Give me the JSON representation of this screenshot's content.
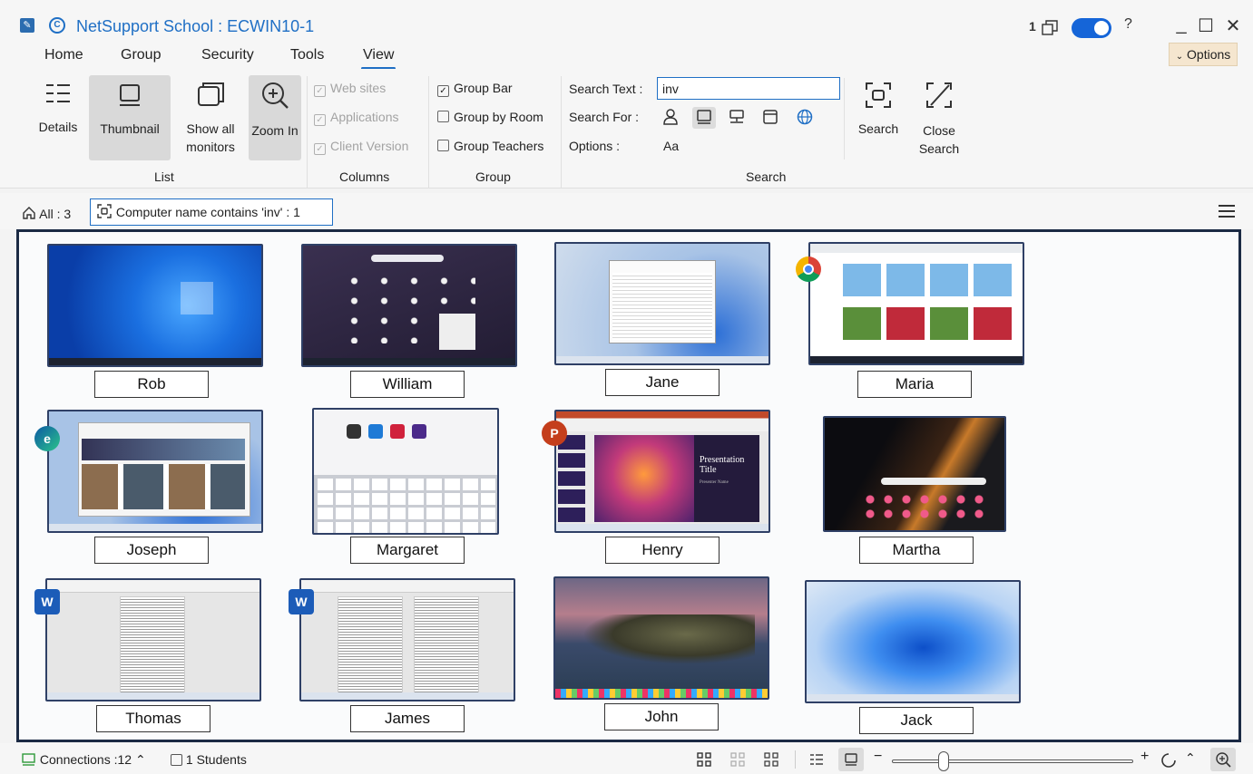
{
  "window": {
    "title": "NetSupport School : ECWIN10-1",
    "notification_count": "1",
    "help": "?",
    "minimize": "_",
    "maximize": "☐",
    "close": "✕"
  },
  "menu": {
    "tabs": [
      "Home",
      "Group",
      "Security",
      "Tools",
      "View"
    ],
    "active": "View",
    "options_label": "Options"
  },
  "ribbon": {
    "list": {
      "label": "List",
      "details": "Details",
      "thumbnail": "Thumbnail",
      "show_all_1": "Show all",
      "show_all_2": "monitors",
      "zoom_in": "Zoom In"
    },
    "columns": {
      "label": "Columns",
      "web_sites": "Web sites",
      "applications": "Applications",
      "client_version": "Client Version"
    },
    "group": {
      "label": "Group",
      "group_bar": "Group Bar",
      "group_by_room": "Group by Room",
      "group_teachers": "Group Teachers"
    },
    "search": {
      "label": "Search",
      "search_text_label": "Search Text :",
      "search_text_value": "inv",
      "search_for_label": "Search For :",
      "options_label": "Options :",
      "options_value": "Aa",
      "search_button": "Search",
      "close_search_1": "Close",
      "close_search_2": "Search"
    }
  },
  "filterbar": {
    "all": "All : 3",
    "filter": "Computer name contains 'inv' : 1"
  },
  "students": [
    {
      "name": "Rob",
      "screen": "win10-blue"
    },
    {
      "name": "William",
      "screen": "chromeos-apps"
    },
    {
      "name": "Jane",
      "screen": "win11-explorer"
    },
    {
      "name": "Maria",
      "screen": "youtube-chrome",
      "app": "chrome-icon"
    },
    {
      "name": "Joseph",
      "screen": "edge-news",
      "app": "edge-icon"
    },
    {
      "name": "Margaret",
      "screen": "ipad-keyboard"
    },
    {
      "name": "Henry",
      "screen": "powerpoint",
      "app": "powerpoint-icon"
    },
    {
      "name": "Martha",
      "screen": "android-dark"
    },
    {
      "name": "Thomas",
      "screen": "word-doc",
      "app": "word-icon"
    },
    {
      "name": "James",
      "screen": "word-doc-2",
      "app": "word-icon"
    },
    {
      "name": "John",
      "screen": "macos-catalina"
    },
    {
      "name": "Jack",
      "screen": "win11-bloom"
    }
  ],
  "powerpoint_slide": {
    "title_1": "Presentation",
    "title_2": "Title",
    "subtitle": "Presenter Name"
  },
  "statusbar": {
    "connections": "Connections :12",
    "students": "1 Students",
    "zoom_fraction": 0.2
  },
  "colors": {
    "accent": "#1f6fc5",
    "grid_border": "#1b2a44",
    "options_bg": "#f5e6cf"
  }
}
